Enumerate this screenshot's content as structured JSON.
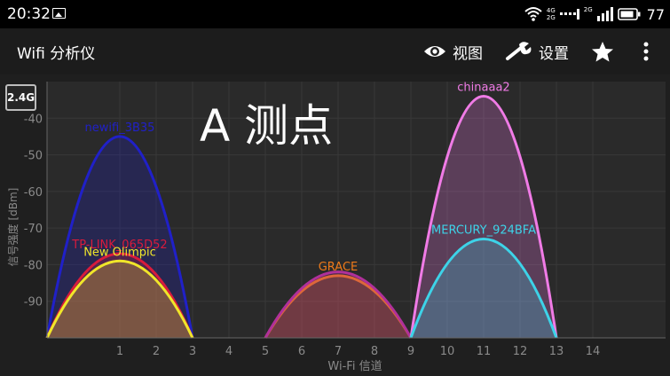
{
  "status_bar": {
    "time": "20:32",
    "network_top": "4G",
    "network_bottom": "2G",
    "network2_top": "2G",
    "battery": "77"
  },
  "app": {
    "title": "Wifi 分析仪",
    "actions": [
      {
        "label": "视图",
        "icon": "eye-icon"
      },
      {
        "label": "设置",
        "icon": "wrench-icon"
      },
      {
        "label": "",
        "icon": "star-icon"
      },
      {
        "label": "",
        "icon": "more-vert-icon"
      }
    ]
  },
  "band_button": "2.4G",
  "overlay_text": "A 测点",
  "chart_data": {
    "type": "area",
    "xlabel": "Wi-Fi 信道",
    "ylabel": "信号强度 [dBm]",
    "xlim": [
      -1,
      16
    ],
    "ylim": [
      -100,
      -30
    ],
    "x_ticks": [
      1,
      2,
      3,
      4,
      5,
      6,
      7,
      8,
      9,
      10,
      11,
      12,
      13,
      14
    ],
    "y_ticks": [
      -40,
      -50,
      -60,
      -70,
      -80,
      -90
    ],
    "grid": true,
    "series": [
      {
        "name": "newifi_3B35",
        "channel": 1,
        "level": -45,
        "color": "#2020c8"
      },
      {
        "name": "TP-LINK_065D52",
        "channel": 1,
        "level": -77,
        "color": "#d81b3c"
      },
      {
        "name": "New Olimpic",
        "channel": 1,
        "level": -79,
        "color": "#f0e62a"
      },
      {
        "name": "GRACE",
        "channel": 7,
        "level": -83,
        "color": "#ee7a1a"
      },
      {
        "name": "",
        "channel": 7,
        "level": -82,
        "color": "#b0309a"
      },
      {
        "name": "chinaaa2",
        "channel": 11,
        "level": -34,
        "color": "#f07be6"
      },
      {
        "name": "MERCURY_924BFA",
        "channel": 11,
        "level": -73,
        "color": "#3dd3e8"
      }
    ]
  }
}
